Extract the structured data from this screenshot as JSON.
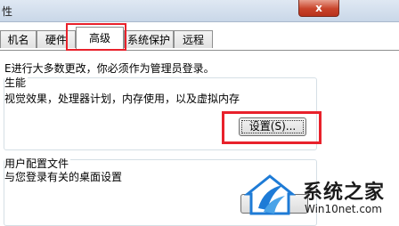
{
  "window": {
    "title": "性",
    "close_label": "x"
  },
  "tabs": [
    {
      "label": "机名"
    },
    {
      "label": "硬件"
    },
    {
      "label": "高级"
    },
    {
      "label": "系统保护"
    },
    {
      "label": "远程"
    }
  ],
  "advanced": {
    "admin_notice": "E进行大多数更改，你必须作为管理员登录。",
    "performance": {
      "title": "生能",
      "description": "视觉效果，处理器计划，内存使用，以及虚拟内存",
      "settings_label": "设置(S)..."
    },
    "user_profiles": {
      "title": "用户配置文件",
      "description": "与您登录有关的桌面设置"
    }
  },
  "watermark": {
    "brand": "系统之家",
    "url": "Win10net.com"
  },
  "colors": {
    "highlight": "#e8212b",
    "accent": "#1e7bd6"
  }
}
